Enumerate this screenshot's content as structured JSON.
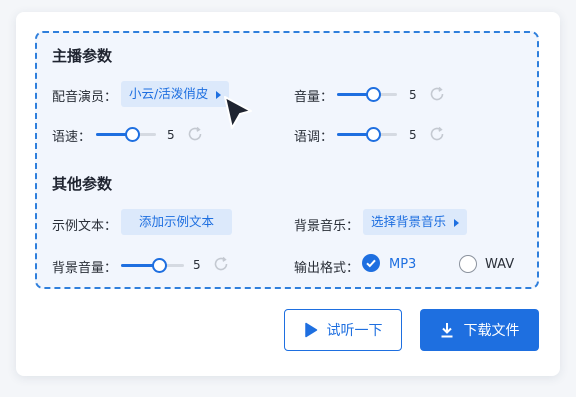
{
  "main_params": {
    "title": "主播参数",
    "voice_actor": {
      "label": "配音演员：",
      "value": "小云/活泼俏皮"
    },
    "volume": {
      "label": "音量：",
      "value": "5",
      "level": 0.6
    },
    "speed": {
      "label": "语速：",
      "value": "5",
      "level": 0.6
    },
    "pitch": {
      "label": "语调：",
      "value": "5",
      "level": 0.6
    }
  },
  "other_params": {
    "title": "其他参数",
    "sample_text": {
      "label": "示例文本：",
      "button": "添加示例文本"
    },
    "bgm": {
      "label": "背景音乐：",
      "button": "选择背景音乐"
    },
    "bgm_volume": {
      "label": "背景音量：",
      "value": "5",
      "level": 0.6
    },
    "output_format": {
      "label": "输出格式：",
      "options": [
        "MP3",
        "WAV"
      ],
      "selected": "MP3"
    }
  },
  "actions": {
    "listen": "试听一下",
    "download": "下载文件"
  },
  "colors": {
    "accent": "#1e6fe0",
    "dashed_border": "#2f7fdc",
    "panel_bg": "#f2f6fd"
  },
  "icons": [
    "play-icon",
    "download-icon",
    "reset-icon",
    "check-icon",
    "mouse-cursor-icon"
  ]
}
